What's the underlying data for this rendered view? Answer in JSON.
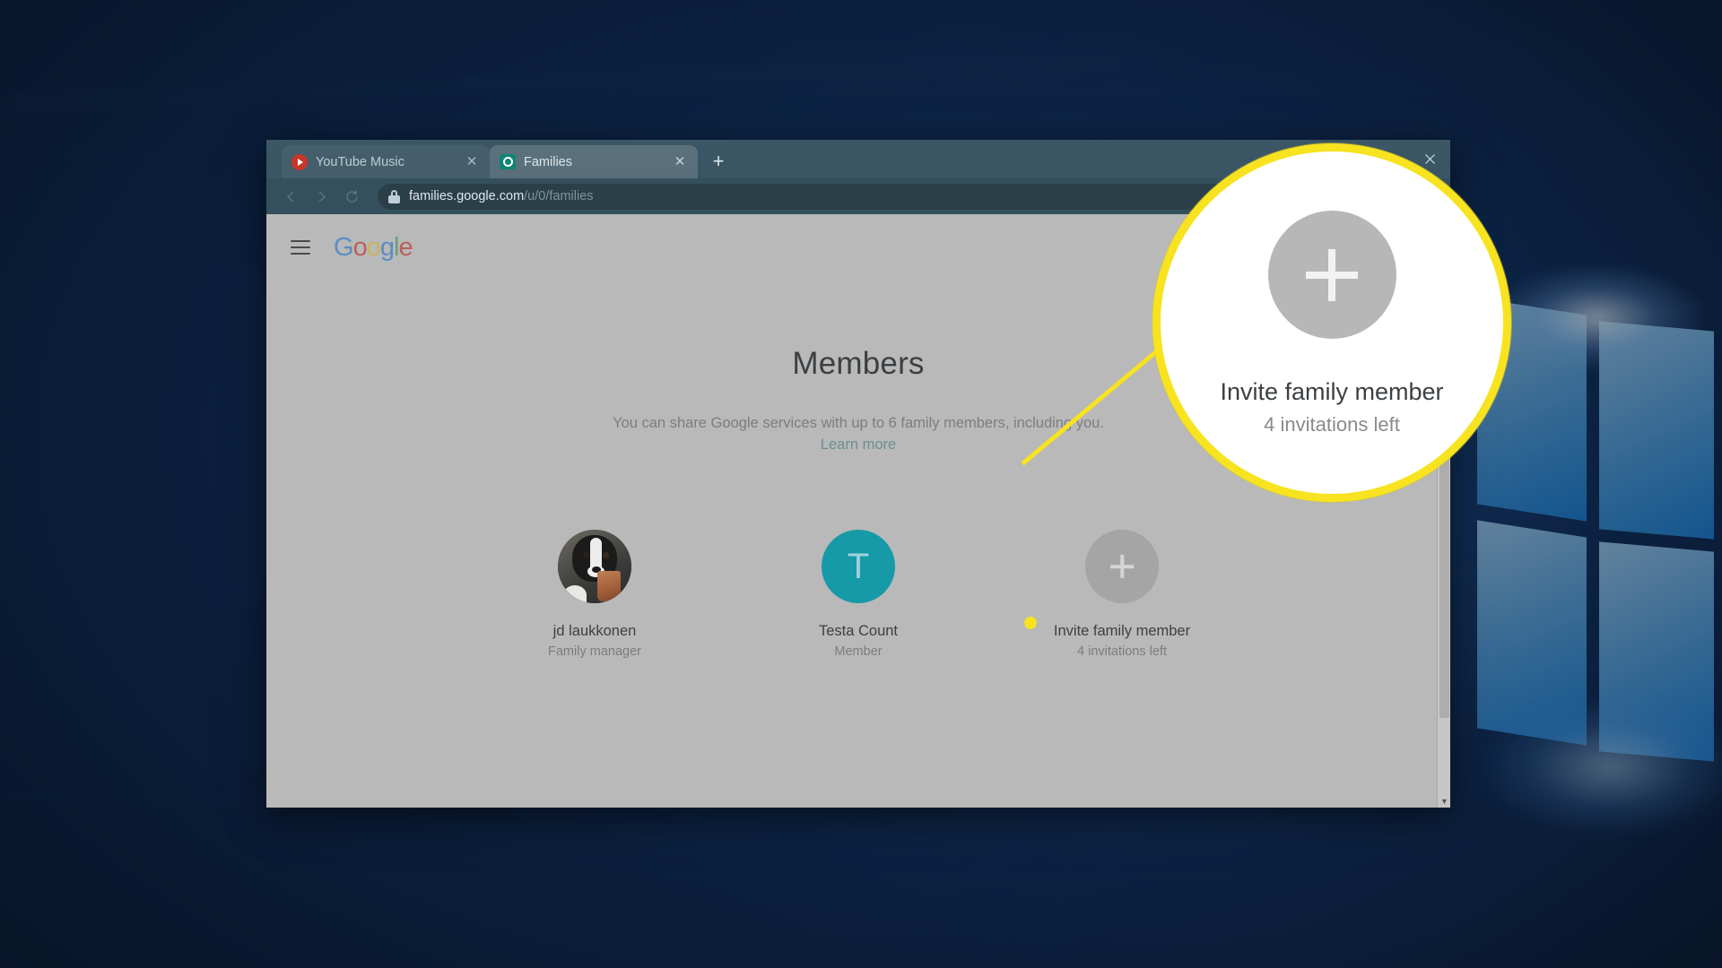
{
  "desktop": {
    "wallpaper_name": "windows-logo-wallpaper"
  },
  "browser": {
    "tabs": [
      {
        "title": "YouTube Music",
        "favicon": "youtube-music-icon",
        "active": false,
        "close_label": "✕"
      },
      {
        "title": "Families",
        "favicon": "google-families-icon",
        "active": true,
        "close_label": "✕"
      }
    ],
    "new_tab_label": "+",
    "window_controls": {
      "minimize": "minimize-icon",
      "maximize": "maximize-icon",
      "close": "close-icon"
    },
    "nav": {
      "back": "back-arrow-icon",
      "forward": "forward-arrow-icon",
      "reload": "reload-icon"
    },
    "omnibox": {
      "security_icon": "lock-icon",
      "host": "families.google.com",
      "path": "/u/0/families",
      "bookmark_icon": "☆"
    }
  },
  "page": {
    "header": {
      "menu_icon": "hamburger-menu-icon",
      "logo_letters": [
        "G",
        "o",
        "o",
        "g",
        "l",
        "e"
      ]
    },
    "title": "Members",
    "subtitle": "You can share Google services with up to 6 family members, including you.",
    "learn_more": "Learn more",
    "members": [
      {
        "name": "jd laukkonen",
        "role": "Family manager",
        "avatar_type": "photo"
      },
      {
        "name": "Testa Count",
        "role": "Member",
        "avatar_type": "letter",
        "initial": "T",
        "color": "#179aa8"
      },
      {
        "name": "Invite family member",
        "role": "4 invitations left",
        "avatar_type": "plus",
        "color": "#a5a5a5"
      }
    ],
    "scrollbar": {
      "down_arrow": "▼"
    }
  },
  "callout": {
    "highlight_color": "#f7e320",
    "magnified": {
      "icon": "plus-icon",
      "title": "Invite family member",
      "subtitle": "4 invitations left"
    }
  }
}
